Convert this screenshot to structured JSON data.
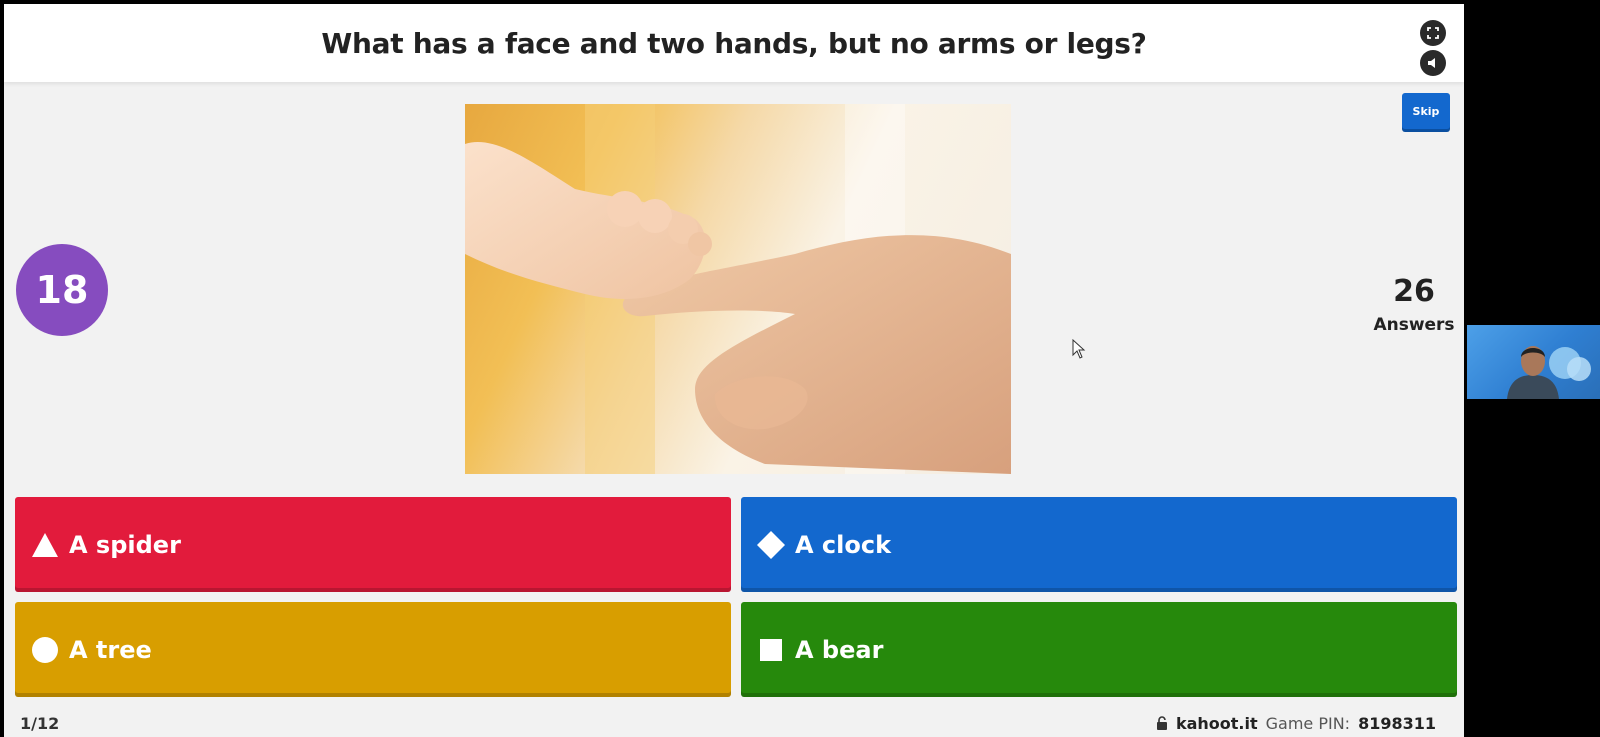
{
  "question": {
    "text": "What has a face and two hands, but no arms or legs?"
  },
  "controls": {
    "fullscreen_icon": "fullscreen-icon",
    "volume_icon": "volume-icon",
    "skip_label": "Skip"
  },
  "timer": {
    "seconds": "18",
    "color": "#864cbf"
  },
  "answers_counter": {
    "count": "26",
    "label": "Answers"
  },
  "image": {
    "description_icon": "baby-hand-photo"
  },
  "answers": [
    {
      "shape": "triangle-icon",
      "label": "A spider",
      "color": "#e21b3c"
    },
    {
      "shape": "diamond-icon",
      "label": "A clock",
      "color": "#1368ce"
    },
    {
      "shape": "circle-icon",
      "label": "A tree",
      "color": "#d89e00"
    },
    {
      "shape": "square-icon",
      "label": "A bear",
      "color": "#26890c"
    }
  ],
  "footer": {
    "progress": "1/12",
    "site": "kahoot.it",
    "pin_label": "Game PIN:",
    "pin": "8198311",
    "lock_icon": "lock-icon"
  }
}
